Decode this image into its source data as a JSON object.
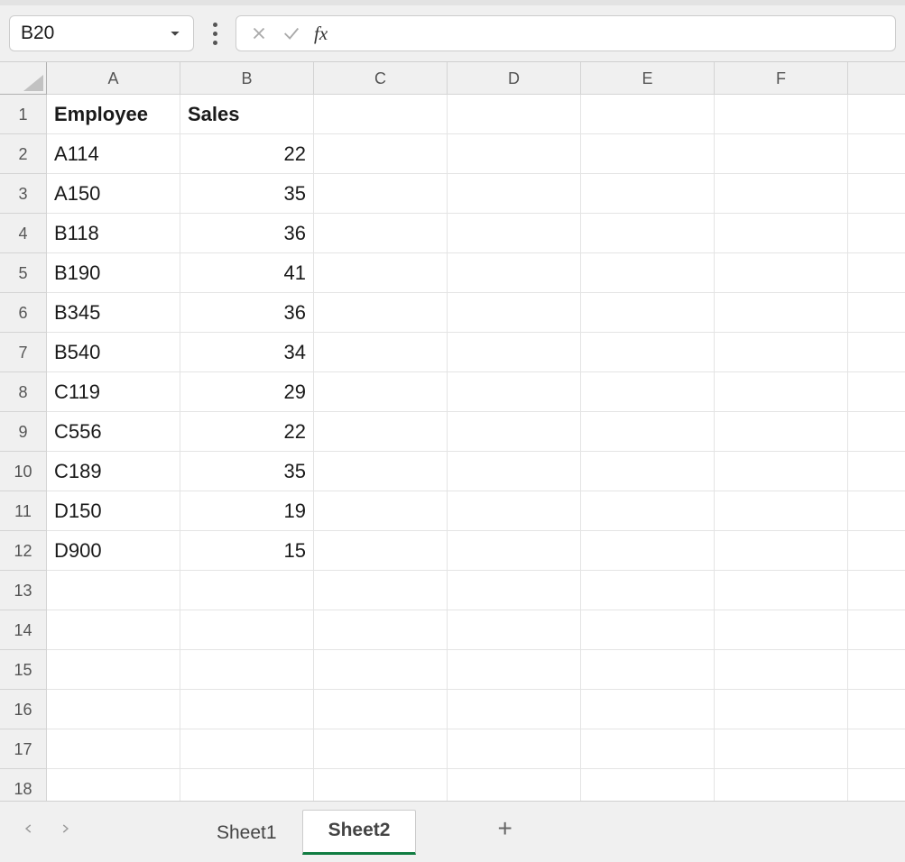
{
  "nameBox": "B20",
  "formulaBar": "",
  "columns": [
    "A",
    "B",
    "C",
    "D",
    "E",
    "F",
    ""
  ],
  "rowCount": 18,
  "cells": {
    "r1": {
      "A": {
        "v": "Employee",
        "bold": true
      },
      "B": {
        "v": "Sales",
        "bold": true
      }
    },
    "r2": {
      "A": {
        "v": "A114"
      },
      "B": {
        "v": "22",
        "num": true
      }
    },
    "r3": {
      "A": {
        "v": "A150"
      },
      "B": {
        "v": "35",
        "num": true
      }
    },
    "r4": {
      "A": {
        "v": "B118"
      },
      "B": {
        "v": "36",
        "num": true
      }
    },
    "r5": {
      "A": {
        "v": "B190"
      },
      "B": {
        "v": "41",
        "num": true
      }
    },
    "r6": {
      "A": {
        "v": "B345"
      },
      "B": {
        "v": "36",
        "num": true
      }
    },
    "r7": {
      "A": {
        "v": "B540"
      },
      "B": {
        "v": "34",
        "num": true
      }
    },
    "r8": {
      "A": {
        "v": "C119"
      },
      "B": {
        "v": "29",
        "num": true
      }
    },
    "r9": {
      "A": {
        "v": "C556"
      },
      "B": {
        "v": "22",
        "num": true
      }
    },
    "r10": {
      "A": {
        "v": "C189"
      },
      "B": {
        "v": "35",
        "num": true
      }
    },
    "r11": {
      "A": {
        "v": "D150"
      },
      "B": {
        "v": "19",
        "num": true
      }
    },
    "r12": {
      "A": {
        "v": "D900"
      },
      "B": {
        "v": "15",
        "num": true
      }
    }
  },
  "sheets": [
    {
      "name": "Sheet1",
      "active": false
    },
    {
      "name": "Sheet2",
      "active": true
    }
  ],
  "fxLabel": "fx"
}
